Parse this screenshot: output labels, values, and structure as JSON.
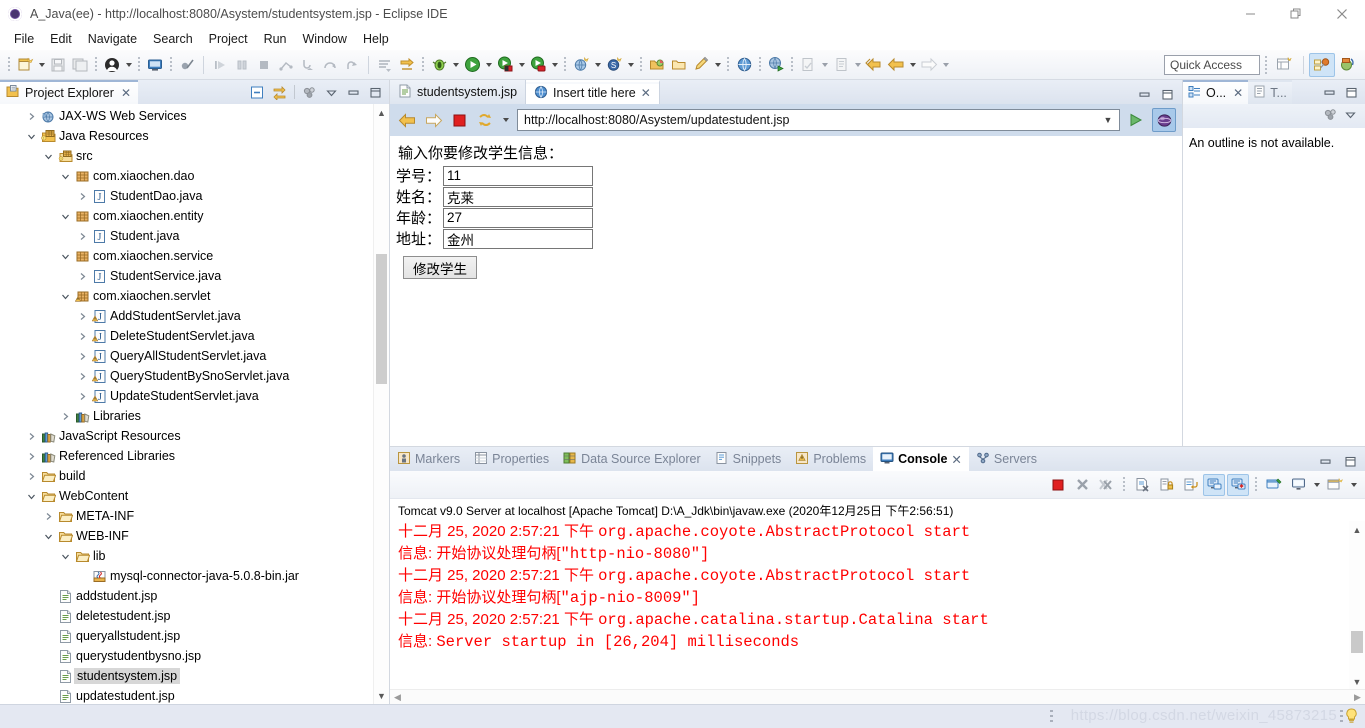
{
  "window": {
    "title": "A_Java(ee) - http://localhost:8080/Asystem/studentsystem.jsp - Eclipse IDE",
    "minimize": "—",
    "restore": "❐",
    "close": "✕"
  },
  "menubar": {
    "items": [
      "File",
      "Edit",
      "Navigate",
      "Search",
      "Project",
      "Run",
      "Window",
      "Help"
    ]
  },
  "toolbar": {
    "quick_access_placeholder": "Quick Access"
  },
  "project_explorer": {
    "tab_label": "Project Explorer",
    "close_glyph": "✕",
    "tree": [
      {
        "label": "JAX-WS Web Services",
        "indent": 1,
        "twist": "collapsed",
        "icon": "jaxws-icon",
        "selected": false
      },
      {
        "label": "Java Resources",
        "indent": 1,
        "twist": "expanded",
        "icon": "java-resources-icon",
        "selected": false
      },
      {
        "label": "src",
        "indent": 2,
        "twist": "expanded",
        "icon": "source-folder-icon",
        "selected": false
      },
      {
        "label": "com.xiaochen.dao",
        "indent": 3,
        "twist": "expanded",
        "icon": "package-icon",
        "selected": false
      },
      {
        "label": "StudentDao.java",
        "indent": 4,
        "twist": "collapsed",
        "icon": "java-file-icon",
        "selected": false
      },
      {
        "label": "com.xiaochen.entity",
        "indent": 3,
        "twist": "expanded",
        "icon": "package-icon",
        "selected": false
      },
      {
        "label": "Student.java",
        "indent": 4,
        "twist": "collapsed",
        "icon": "java-file-icon",
        "selected": false
      },
      {
        "label": "com.xiaochen.service",
        "indent": 3,
        "twist": "expanded",
        "icon": "package-icon",
        "selected": false
      },
      {
        "label": "StudentService.java",
        "indent": 4,
        "twist": "collapsed",
        "icon": "java-file-icon",
        "selected": false
      },
      {
        "label": "com.xiaochen.servlet",
        "indent": 3,
        "twist": "expanded",
        "icon": "package-warning-icon",
        "selected": false
      },
      {
        "label": "AddStudentServlet.java",
        "indent": 4,
        "twist": "collapsed",
        "icon": "java-file-warning-icon",
        "selected": false
      },
      {
        "label": "DeleteStudentServlet.java",
        "indent": 4,
        "twist": "collapsed",
        "icon": "java-file-warning-icon",
        "selected": false
      },
      {
        "label": "QueryAllStudentServlet.java",
        "indent": 4,
        "twist": "collapsed",
        "icon": "java-file-warning-icon",
        "selected": false
      },
      {
        "label": "QueryStudentBySnoServlet.java",
        "indent": 4,
        "twist": "collapsed",
        "icon": "java-file-warning-icon",
        "selected": false
      },
      {
        "label": "UpdateStudentServlet.java",
        "indent": 4,
        "twist": "collapsed",
        "icon": "java-file-warning-icon",
        "selected": false
      },
      {
        "label": "Libraries",
        "indent": 3,
        "twist": "collapsed",
        "icon": "library-icon",
        "selected": false
      },
      {
        "label": "JavaScript Resources",
        "indent": 1,
        "twist": "collapsed",
        "icon": "library-icon",
        "selected": false
      },
      {
        "label": "Referenced Libraries",
        "indent": 1,
        "twist": "collapsed",
        "icon": "library-icon",
        "selected": false
      },
      {
        "label": "build",
        "indent": 1,
        "twist": "collapsed",
        "icon": "folder-icon",
        "selected": false
      },
      {
        "label": "WebContent",
        "indent": 1,
        "twist": "expanded",
        "icon": "folder-icon",
        "selected": false
      },
      {
        "label": "META-INF",
        "indent": 2,
        "twist": "collapsed",
        "icon": "folder-icon",
        "selected": false
      },
      {
        "label": "WEB-INF",
        "indent": 2,
        "twist": "expanded",
        "icon": "folder-icon",
        "selected": false
      },
      {
        "label": "lib",
        "indent": 3,
        "twist": "expanded",
        "icon": "folder-icon",
        "selected": false
      },
      {
        "label": "mysql-connector-java-5.0.8-bin.jar",
        "indent": 4,
        "twist": "none",
        "icon": "jar-icon",
        "selected": false
      },
      {
        "label": "addstudent.jsp",
        "indent": 2,
        "twist": "none",
        "icon": "jsp-file-icon",
        "selected": false
      },
      {
        "label": "deletestudent.jsp",
        "indent": 2,
        "twist": "none",
        "icon": "jsp-file-icon",
        "selected": false
      },
      {
        "label": "queryallstudent.jsp",
        "indent": 2,
        "twist": "none",
        "icon": "jsp-file-icon",
        "selected": false
      },
      {
        "label": "querystudentbysno.jsp",
        "indent": 2,
        "twist": "none",
        "icon": "jsp-file-icon",
        "selected": false
      },
      {
        "label": "studentsystem.jsp",
        "indent": 2,
        "twist": "none",
        "icon": "jsp-file-icon",
        "selected": true
      },
      {
        "label": "updatestudent.jsp",
        "indent": 2,
        "twist": "none",
        "icon": "jsp-file-icon",
        "selected": false
      }
    ]
  },
  "editor": {
    "tabs": [
      {
        "label": "studentsystem.jsp",
        "icon": "jsp-file-icon",
        "active": false,
        "closable": false
      },
      {
        "label": "Insert title here",
        "icon": "globe-icon",
        "active": true,
        "closable": true
      }
    ],
    "close_glyph": "✕",
    "browser": {
      "back_title": "Back",
      "forward_title": "Forward",
      "stop_title": "Stop",
      "refresh_title": "Refresh",
      "url": "http://localhost:8080/Asystem/updatestudent.jsp",
      "go_title": "Go"
    },
    "page": {
      "heading": "输入你要修改学生信息：",
      "fields": [
        {
          "label": "学号：",
          "value": "11"
        },
        {
          "label": "姓名：",
          "value": "克莱"
        },
        {
          "label": "年龄：",
          "value": "27"
        },
        {
          "label": "地址：",
          "value": "金州"
        }
      ],
      "submit_label": "修改学生"
    }
  },
  "outline": {
    "tabs": [
      {
        "label": "O...",
        "icon": "outline-icon",
        "active": true,
        "closable": true
      },
      {
        "label": "T...",
        "icon": "task-list-icon",
        "active": false,
        "closable": false
      }
    ],
    "close_glyph": "✕",
    "empty_message": "An outline is not available."
  },
  "console": {
    "tabs": [
      {
        "label": "Markers",
        "icon": "markers-icon",
        "active": false,
        "closable": false
      },
      {
        "label": "Properties",
        "icon": "properties-icon",
        "active": false,
        "closable": false
      },
      {
        "label": "Data Source Explorer",
        "icon": "data-source-icon",
        "active": false,
        "closable": false
      },
      {
        "label": "Snippets",
        "icon": "snippets-icon",
        "active": false,
        "closable": false
      },
      {
        "label": "Problems",
        "icon": "problems-icon",
        "active": false,
        "closable": false
      },
      {
        "label": "Console",
        "icon": "console-icon",
        "active": true,
        "closable": true
      },
      {
        "label": "Servers",
        "icon": "servers-icon",
        "active": false,
        "closable": false
      }
    ],
    "close_glyph": "✕",
    "header": "Tomcat v9.0 Server at localhost [Apache Tomcat] D:\\A_Jdk\\bin\\javaw.exe (2020年12月25日 下午2:56:51)",
    "text_color": "#ff0000",
    "lines": [
      {
        "prefix": "十二月 25, 2020 2:57:21 下午 ",
        "mono": "org.apache.coyote.AbstractProtocol start"
      },
      {
        "prefix": "信息: 开始协议处理句柄[",
        "mono": "\"http-nio-8080\"]"
      },
      {
        "prefix": "十二月 25, 2020 2:57:21 下午 ",
        "mono": "org.apache.coyote.AbstractProtocol start"
      },
      {
        "prefix": "信息: 开始协议处理句柄[",
        "mono": "\"ajp-nio-8009\"]"
      },
      {
        "prefix": "十二月 25, 2020 2:57:21 下午 ",
        "mono": "org.apache.catalina.startup.Catalina start"
      },
      {
        "prefix": "信息: ",
        "mono": "Server startup in [26,204] milliseconds"
      }
    ]
  },
  "statusbar": {
    "watermark": "https://blog.csdn.net/weixin_45873215"
  }
}
